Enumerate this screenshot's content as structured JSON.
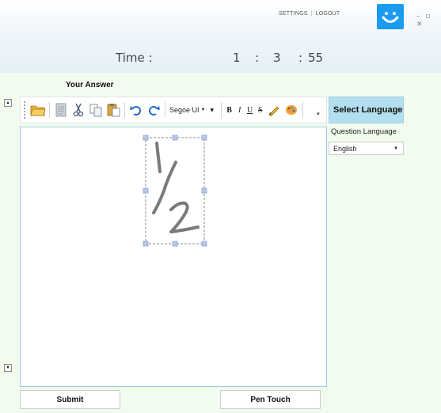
{
  "header": {
    "settings_label": "SETTINGS",
    "separator": "|",
    "logout_label": "LOGOUT",
    "brand_color": "#1a9bf0",
    "window_controls": "– ▫ ✕"
  },
  "timer": {
    "label": "Time :",
    "hours": "1",
    "sep1": ":",
    "minutes": "3",
    "sep2": ":",
    "seconds": "55"
  },
  "answer": {
    "title": "Your Answer",
    "toolbar": {
      "font_family": "Segoe UI",
      "bold": "B",
      "italic": "I",
      "underline": "U",
      "strike": "S"
    }
  },
  "language": {
    "select_label": "Select Language",
    "question_label": "Question Language",
    "selected": "English"
  },
  "buttons": {
    "submit": "Submit",
    "pen_touch": "Pen Touch"
  },
  "colors": {
    "panel_bg": "#f1fcef",
    "language_header_bg": "#b4dff0",
    "editor_border": "#9ccbdc"
  }
}
